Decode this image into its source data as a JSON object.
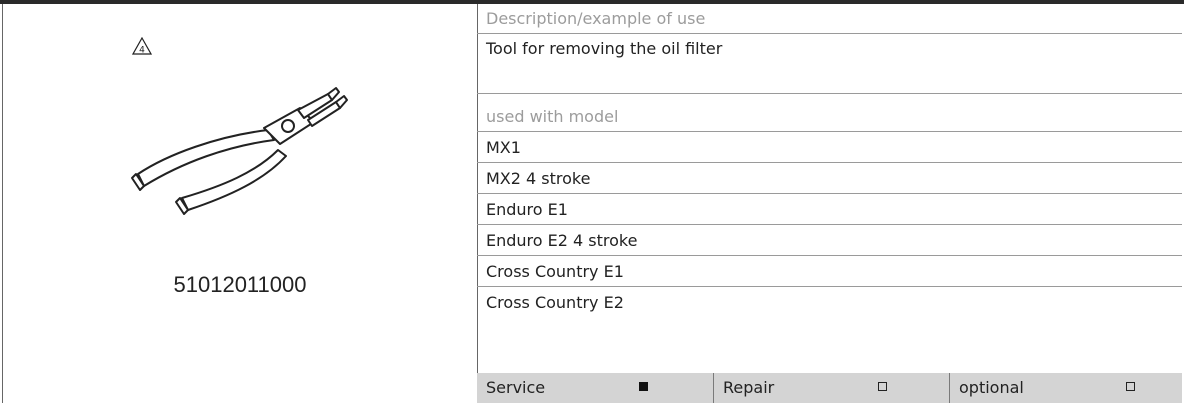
{
  "tool": {
    "reference_number": "4",
    "part_number": "51012011000",
    "icon": "circlip-pliers-icon"
  },
  "description": {
    "heading": "Description/example of use",
    "text": "Tool for removing the oil filter"
  },
  "models": {
    "heading": "used with model",
    "items": [
      "MX1",
      "MX2 4 stroke",
      "Enduro E1",
      "Enduro E2 4 stroke",
      "Cross Country E1",
      "Cross Country E2"
    ]
  },
  "usage": [
    {
      "label": "Service",
      "checked": true
    },
    {
      "label": "Repair",
      "checked": false
    },
    {
      "label": "optional",
      "checked": false
    }
  ]
}
